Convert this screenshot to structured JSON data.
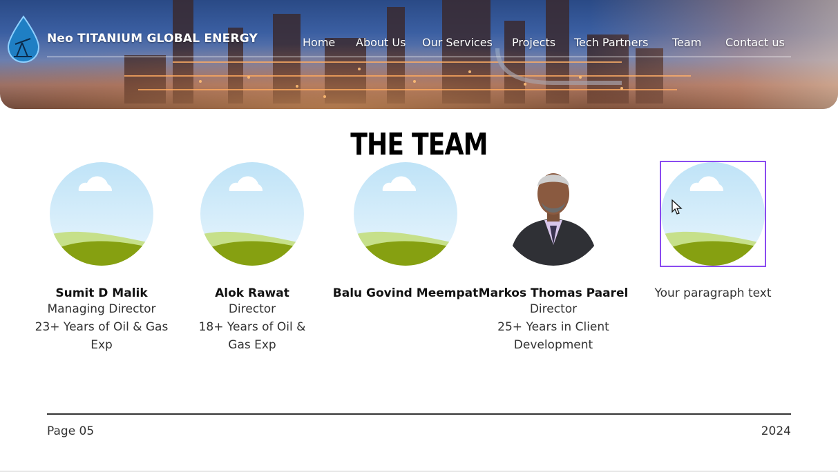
{
  "brand": {
    "name": "Neo TITANIUM GLOBAL ENERGY"
  },
  "nav": {
    "items": [
      {
        "label": "Home"
      },
      {
        "label": "About Us"
      },
      {
        "label": "Our Services"
      },
      {
        "label": "Projects"
      },
      {
        "label": "Tech Partners"
      },
      {
        "label": "Team"
      },
      {
        "label": "Contact us"
      }
    ]
  },
  "section": {
    "title": "THE TEAM"
  },
  "team": [
    {
      "name": "Sumit D Malik",
      "role": "Managing Director",
      "exp1": "23+ Years of Oil & Gas",
      "exp2": "Exp"
    },
    {
      "name": "Alok Rawat",
      "role": "Director",
      "exp1": "18+ Years of Oil &",
      "exp2": "Gas Exp"
    },
    {
      "name": "Balu Govind Meempat"
    },
    {
      "name": "Markos Thomas Paarel",
      "role": "Director",
      "exp1": "25+ Years in Client",
      "exp2": "Development"
    },
    {
      "placeholder": "Your paragraph text"
    }
  ],
  "footer": {
    "page": "Page 05",
    "year": "2024"
  },
  "colors": {
    "selection": "#8a4bf0",
    "accent_logo": "#1f7fc4"
  }
}
